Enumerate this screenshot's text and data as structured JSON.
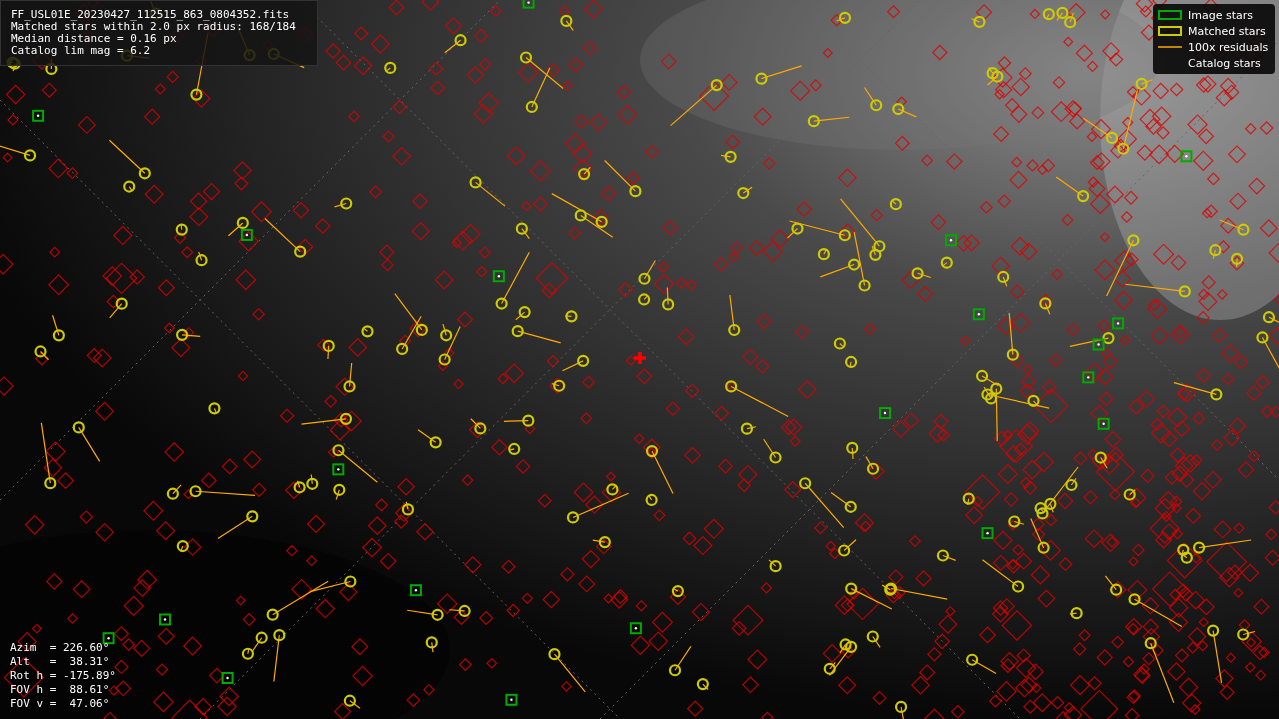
{
  "info_box": {
    "lines": [
      "FF_USL01E_20230427_112515_863_0804352.fits",
      "Matched stars within 2.0 px radius: 168/184",
      "Median distance = 0.16 px",
      "Catalog lim mag = 6.2"
    ]
  },
  "legend": [
    {
      "label": "Image stars",
      "kind": "image"
    },
    {
      "label": "Matched stars",
      "kind": "matched"
    },
    {
      "label": "100x residuals",
      "kind": "residual"
    },
    {
      "label": "Catalog stars",
      "kind": "catalog"
    }
  ],
  "pointing": {
    "lines": [
      "Azim  = 226.60°",
      "Alt   =  38.31°",
      "Rot h = -175.89°",
      "FOV h =  88.61°",
      "FOV v =  47.06°"
    ]
  }
}
